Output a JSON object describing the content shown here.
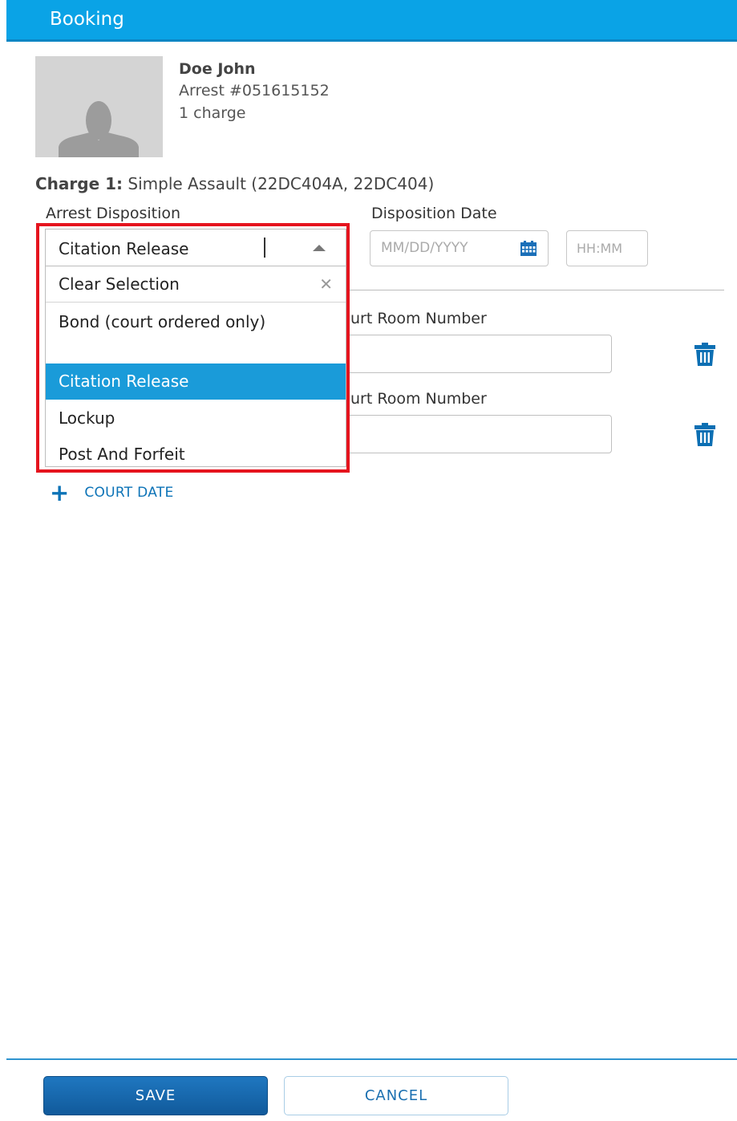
{
  "header": {
    "title": "Booking"
  },
  "person": {
    "name": "Doe John",
    "arrest": "Arrest #051615152",
    "charges": "1 charge"
  },
  "charge": {
    "label": "Charge 1:",
    "description": "Simple Assault (22DC404A, 22DC404)"
  },
  "form": {
    "arrest_disposition_label": "Arrest Disposition",
    "disposition_date_label": "Disposition Date",
    "date_placeholder": "MM/DD/YYYY",
    "time_placeholder": "HH:MM",
    "court_room_label_1": "urt Room Number",
    "court_room_label_2": "urt Room Number",
    "add_court_date_label": "COURT DATE"
  },
  "dropdown": {
    "selected_value": "Citation Release",
    "clear_label": "Clear Selection",
    "options": [
      "Bond (court ordered only)",
      "Citation Release",
      "Lockup",
      "Post And Forfeit"
    ]
  },
  "icons": {
    "calendar": "calendar-icon",
    "trash": "trash-icon",
    "clear": "close-icon",
    "avatar": "person-placeholder-icon",
    "add": "plus-icon"
  },
  "colors": {
    "header_bg": "#0aa3e6",
    "accent": "#0c73b7",
    "selected_option": "#1a9bd9",
    "highlight_outline": "#e5141e"
  },
  "footer": {
    "save_label": "SAVE",
    "cancel_label": "CANCEL"
  }
}
